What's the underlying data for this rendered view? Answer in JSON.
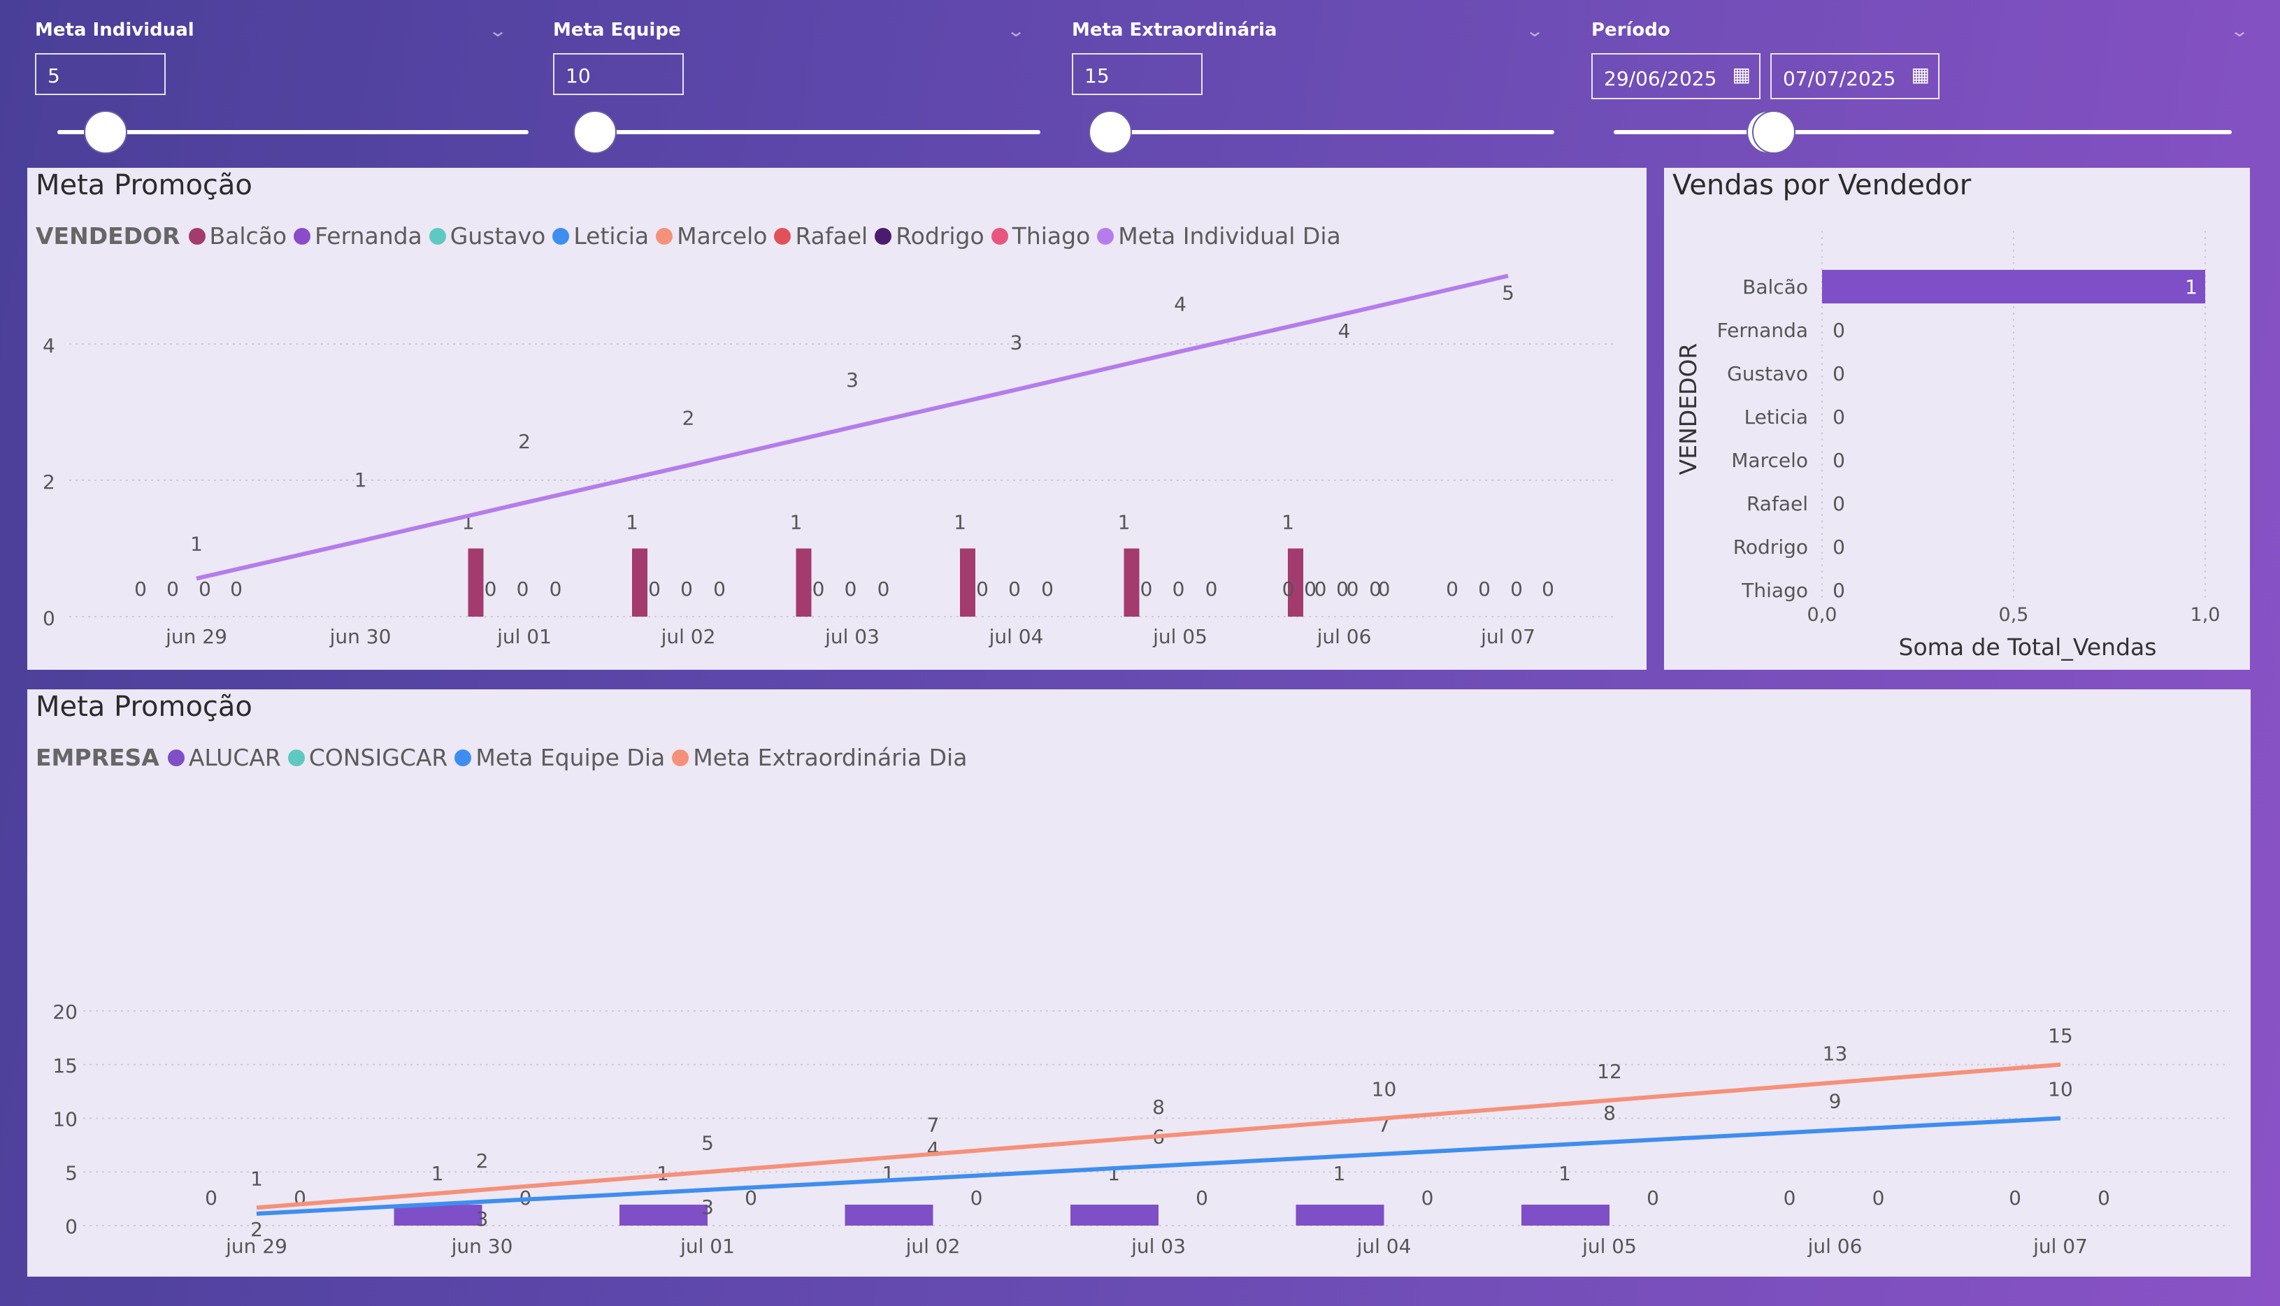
{
  "slicers": [
    {
      "title": "Meta Individual",
      "value": "5"
    },
    {
      "title": "Meta Equipe",
      "value": "10"
    },
    {
      "title": "Meta Extraordinária",
      "value": "15"
    }
  ],
  "period": {
    "title": "Período",
    "start": "29/06/2025",
    "end": "07/07/2025"
  },
  "chart_data": [
    {
      "type": "bar",
      "title": "Meta Promoção",
      "legend_title": "VENDEDOR",
      "legend": [
        {
          "name": "Balcão",
          "color": "#a33b6e"
        },
        {
          "name": "Fernanda",
          "color": "#8a4cc8"
        },
        {
          "name": "Gustavo",
          "color": "#5ec9c0"
        },
        {
          "name": "Leticia",
          "color": "#3e8ef0"
        },
        {
          "name": "Marcelo",
          "color": "#f5917a"
        },
        {
          "name": "Rafael",
          "color": "#e05258"
        },
        {
          "name": "Rodrigo",
          "color": "#4b1c6e"
        },
        {
          "name": "Thiago",
          "color": "#e8557f"
        },
        {
          "name": "Meta Individual Dia",
          "color": "#b57ceb"
        }
      ],
      "categories": [
        "jun 29",
        "jun 30",
        "jul 01",
        "jul 02",
        "jul 03",
        "jul 04",
        "jul 05",
        "jul 06",
        "jul 07"
      ],
      "series": [
        {
          "name": "Balcão",
          "values": [
            0,
            1,
            1,
            1,
            1,
            1,
            1,
            0,
            0
          ]
        },
        {
          "name": "Fernanda",
          "values": [
            0,
            0,
            0,
            0,
            0,
            0,
            0,
            0,
            0
          ]
        },
        {
          "name": "Gustavo",
          "values": [
            0,
            0,
            0,
            0,
            0,
            0,
            0,
            0,
            0
          ]
        },
        {
          "name": "Leticia",
          "values": [
            0,
            0,
            0,
            0,
            0,
            0,
            0,
            0,
            0
          ]
        },
        {
          "name": "Marcelo",
          "values": [
            0,
            0,
            0,
            0,
            0,
            0,
            0,
            0,
            0
          ]
        },
        {
          "name": "Rafael",
          "values": [
            0,
            0,
            0,
            0,
            0,
            0,
            0,
            0,
            0
          ]
        },
        {
          "name": "Rodrigo",
          "values": [
            0,
            0,
            0,
            0,
            0,
            0,
            0,
            0,
            0
          ]
        },
        {
          "name": "Thiago",
          "values": [
            0,
            0,
            0,
            0,
            0,
            0,
            0,
            0,
            0
          ]
        }
      ],
      "bar_labels": [
        [
          "0",
          "0",
          "0",
          "0"
        ],
        [
          "1",
          "0",
          "0",
          "0"
        ],
        [
          "1",
          "0",
          "0",
          "0"
        ],
        [
          "1",
          "0",
          "0",
          "0"
        ],
        [
          "1",
          "0",
          "0",
          "0"
        ],
        [
          "1",
          "0",
          "0",
          "0"
        ],
        [
          "1",
          "0",
          "0",
          "0"
        ],
        [
          "0",
          "0",
          "0",
          "0"
        ],
        [
          "0",
          "0",
          "0",
          "0"
        ]
      ],
      "line": {
        "name": "Meta Individual Dia",
        "values": [
          0.56,
          1.11,
          1.67,
          2.22,
          2.78,
          3.33,
          3.89,
          4.44,
          5.0
        ],
        "labels": [
          "1",
          "1",
          "2",
          "2",
          "3",
          "3",
          "4",
          "4",
          "5"
        ]
      },
      "yticks": [
        "0",
        "2",
        "4"
      ],
      "ylim": [
        0,
        5.2
      ]
    },
    {
      "type": "bar",
      "title": "Vendas por Vendedor",
      "orientation": "horizontal",
      "categories": [
        "Balcão",
        "Fernanda",
        "Gustavo",
        "Leticia",
        "Marcelo",
        "Rafael",
        "Rodrigo",
        "Thiago"
      ],
      "values": [
        1,
        0,
        0,
        0,
        0,
        0,
        0,
        0
      ],
      "value_labels": [
        "1",
        "0",
        "0",
        "0",
        "0",
        "0",
        "0",
        "0"
      ],
      "xticks": [
        "0,0",
        "0,5",
        "1,0"
      ],
      "xlim": [
        0,
        1
      ],
      "xlabel": "Soma de Total_Vendas",
      "ylabel": "VENDEDOR",
      "color": "#7e4fc6"
    },
    {
      "type": "bar",
      "title": "Meta Promoção",
      "legend_title": "EMPRESA",
      "legend": [
        {
          "name": "ALUCAR",
          "color": "#7e4fc6"
        },
        {
          "name": "CONSIGCAR",
          "color": "#5ec9c0"
        },
        {
          "name": "Meta Equipe Dia",
          "color": "#3e8ef0"
        },
        {
          "name": "Meta Extraordinária Dia",
          "color": "#f5917a"
        }
      ],
      "categories": [
        "jun 29",
        "jun 30",
        "jul 01",
        "jul 02",
        "jul 03",
        "jul 04",
        "jul 05",
        "jul 06",
        "jul 07"
      ],
      "series": [
        {
          "name": "ALUCAR",
          "values": [
            0,
            1,
            1,
            1,
            1,
            1,
            1,
            0,
            0
          ]
        },
        {
          "name": "CONSIGCAR",
          "values": [
            0,
            0,
            0,
            0,
            0,
            0,
            0,
            0,
            0
          ]
        }
      ],
      "bar_labels": [
        [
          "0",
          "0"
        ],
        [
          "1",
          "0"
        ],
        [
          "1",
          "0"
        ],
        [
          "1",
          "0"
        ],
        [
          "1",
          "0"
        ],
        [
          "1",
          "0"
        ],
        [
          "1",
          "0"
        ],
        [
          "0",
          "0"
        ],
        [
          "0",
          "0"
        ]
      ],
      "lines": [
        {
          "name": "Meta Equipe Dia",
          "color": "#3e8ef0",
          "values": [
            1.11,
            2.22,
            3.33,
            4.44,
            5.56,
            6.67,
            7.78,
            8.89,
            10.0
          ],
          "labels": [
            "2",
            "3",
            "3",
            "4",
            "6",
            "7",
            "8",
            "9",
            "10"
          ]
        },
        {
          "name": "Meta Extraordinária Dia",
          "color": "#f5917a",
          "values": [
            1.67,
            3.33,
            5.0,
            6.67,
            8.33,
            10.0,
            11.67,
            13.33,
            15.0
          ],
          "labels": [
            "1",
            "2",
            "5",
            "7",
            "8",
            "10",
            "12",
            "13",
            "15"
          ]
        }
      ],
      "yticks": [
        "0",
        "5",
        "10",
        "15",
        "20"
      ],
      "ylim": [
        0,
        20
      ]
    }
  ]
}
